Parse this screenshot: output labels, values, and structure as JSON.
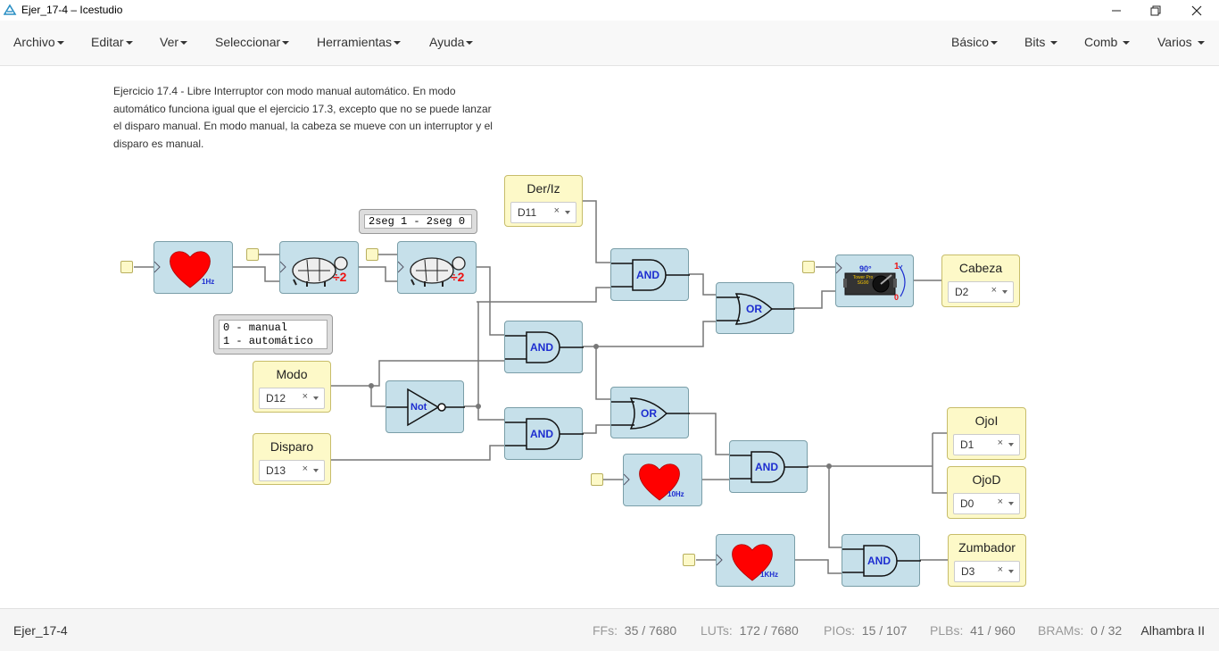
{
  "window": {
    "title": "Ejer_17-4 – Icestudio",
    "minimize_icon": "minimize-icon",
    "maximize_icon": "restore-icon",
    "close_icon": "close-icon"
  },
  "menu": {
    "left": [
      {
        "label": "Archivo"
      },
      {
        "label": "Editar"
      },
      {
        "label": "Ver"
      },
      {
        "label": "Seleccionar"
      },
      {
        "label": "Herramientas"
      },
      {
        "label": "Ayuda"
      }
    ],
    "right": [
      {
        "label": "Básico"
      },
      {
        "label": "Bits"
      },
      {
        "label": "Comb"
      },
      {
        "label": "Varios"
      }
    ]
  },
  "canvas": {
    "description": "Ejercicio 17.4 - Libre Interruptor con modo manual automático. En modo automático funciona igual que el ejercicio 17.3, excepto que no se puede lanzar el disparo manual. En modo manual, la cabeza se mueve con un interruptor y el disparo es manual.",
    "comments": {
      "seg": "2seg 1 - 2seg 0",
      "mode": "0 - manual\n1 - automático"
    },
    "inputs": [
      {
        "label": "Der/Iz",
        "pin": "D11"
      },
      {
        "label": "Modo",
        "pin": "D12"
      },
      {
        "label": "Disparo",
        "pin": "D13"
      }
    ],
    "outputs": [
      {
        "label": "Cabeza",
        "pin": "D2"
      },
      {
        "label": "OjoI",
        "pin": "D1"
      },
      {
        "label": "OjoD",
        "pin": "D0"
      },
      {
        "label": "Zumbador",
        "pin": "D3"
      }
    ],
    "pin_clear": "×",
    "heart_freqs": [
      "1Hz",
      "10Hz",
      "1KHz"
    ],
    "divider_label": "÷2",
    "gates": {
      "and": "AND",
      "or": "OR",
      "not": "Not"
    },
    "servo": {
      "angle": "90°",
      "label_one": "1",
      "label_zero": "0",
      "chip_text": "Tower Pro SG90"
    }
  },
  "status": {
    "project": "Ejer_17-4",
    "ffs_label": "FFs:",
    "ffs": "35 / 7680",
    "luts_label": "LUTs:",
    "luts": "172 / 7680",
    "pios_label": "PIOs:",
    "pios": "15 / 107",
    "plbs_label": "PLBs:",
    "plbs": "41 / 960",
    "brams_label": "BRAMs:",
    "brams": "0 / 32",
    "board": "Alhambra II"
  },
  "colors": {
    "block_fill": "#c6e0ea",
    "io_fill": "#fdf9c8",
    "wire": "#777777",
    "gate_label": "#1d2dd0",
    "heart": "#ff0000"
  }
}
